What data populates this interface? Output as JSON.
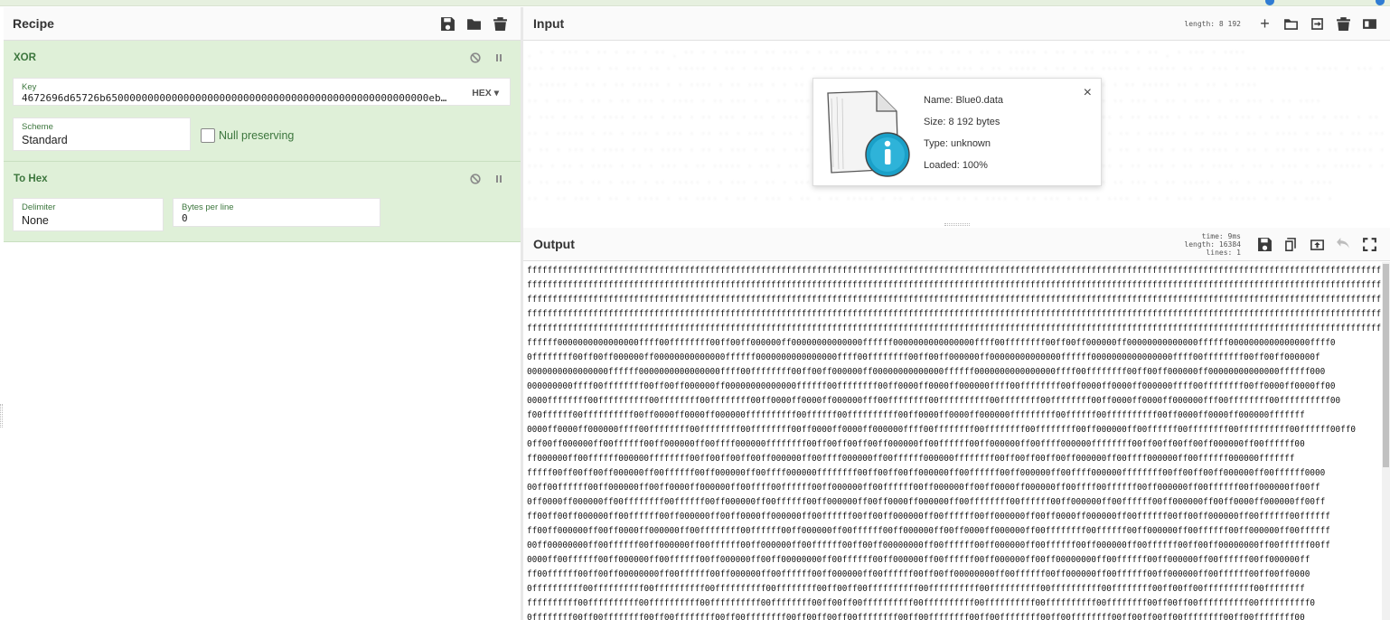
{
  "recipe": {
    "title": "Recipe",
    "icons": [
      "save-icon",
      "folder-icon",
      "trash-icon"
    ],
    "operations": [
      {
        "name": "XOR",
        "key_label": "Key",
        "key_value": "4672696d65726b650000000000000000000000000000000000000000000000000000eb…",
        "key_format": "HEX",
        "scheme_label": "Scheme",
        "scheme_value": "Standard",
        "null_preserving_label": "Null preserving",
        "null_preserving_checked": false
      },
      {
        "name": "To Hex",
        "delimiter_label": "Delimiter",
        "delimiter_value": "None",
        "bytes_per_line_label": "Bytes per line",
        "bytes_per_line_value": "0"
      }
    ]
  },
  "input": {
    "title": "Input",
    "length_text": "length: 8 192",
    "icons": [
      "plus-icon",
      "folder-icon",
      "input-file-icon",
      "trash-icon",
      "layout-icon"
    ]
  },
  "file_popup": {
    "name": "Name: Blue0.data",
    "size": "Size: 8 192 bytes",
    "type": "Type: unknown",
    "loaded": "Loaded: 100%",
    "close_label": "×"
  },
  "output": {
    "title": "Output",
    "time_text": "time:  9ms",
    "length_text": "length: 16384",
    "lines_text": "lines:    1",
    "icons": [
      "save-icon",
      "copy-icon",
      "replace-input-icon",
      "undo-icon",
      "fullscreen-icon"
    ],
    "lines": [
      "ffffffffffffffffffffffffffffffffffffffffffffffffffffffffffffffffffffffffffffffffffffffffffffffffffffffffffffffffffffffffffffffffffffffffffffffffffffffffffffffffffffffffffffffffffffffffffffffffff",
      "ffffffffffffffffffffffffffffffffffffffffffffffffffffffffffffffffffffffffffffffffffffffffffffffffffffffffffffffffffffffffffffffffffffffffffffffffffffffffffffffffffffffffffffffffffffffffffffffffffff",
      "ffffffffffffffffffffffffffffffffffffffffffffffffffffffffffffffffffffffffffffffffffffffffffffffffffffffffffffffffffffffffffffffffffffffffffffffffffffffffffffffffffffffffffffffffffffffffffffffffffff",
      "ffffffffffffffffffffffffffffffffffffffffffffffffffffffffffffffffffffffffffffffffffffffffffffffffffffffffffffffffffffffffffffffffffffffffffffffffffffffffffffffffffffffffffffffffffffffffffffffffffff",
      "ffffffffffffffffffffffffffffffffffffffffffffffffffffffffffffffffffffffffffffffffffffffffffffffffffffffffffffffffffffffffffffffffffffffffffffffffffffffffffffffffffffffffffffffffffffffffffffffffffff",
      "ffffff0000000000000000ffff00ffffffff00ff00ff000000ff00000000000000ffffff0000000000000000ffff00ffffffff00ff00ff000000ff00000000000000ffffff0000000000000000ffff0",
      "0ffffffff00ff00ff000000ff00000000000000ffffff0000000000000000ffff00ffffffff00ff00ff000000ff00000000000000ffffff0000000000000000ffff00ffffffff00ff00ff000000f",
      "0000000000000000ffffff0000000000000000ffff00ffffffff00ff00ff000000ff00000000000000ffffff0000000000000000ffff00ffffffff00ff00ff000000ff00000000000000ffffff000",
      "000000000ffff00ffffffff00ff00ff000000ff00000000000000ffffff00ffffffff00ff0000ff0000ff000000ffff00ffffffff00ff0000ff0000ff000000ffff00ffffffff00ff0000ff0000ff00",
      "0000ffffffff00ffffffffff00ffffffff00ffffffff00ff0000ff0000ff000000fff00ffffffff00ffffffffff00ffffffff00ffffffff00ff0000ff0000ff000000fff00ffffffff00ffffffffff00",
      "f00ffffff00ffffffffff00ff0000ff0000ff000000ffffffffff00ffffff00ffffffffff00ff0000ff0000ff000000fffffffff00ffffff00ffffffffff00ff0000ff0000ff000000fffffff",
      "0000ff0000ff000000ffff00ffffffff00ffffffff00ffffffff00ff0000ff0000ff000000ffff00ffffffff00ffffffff00ffffffff00ff000000ff00ffffff00ffffffff00ffffffffff00ffffff00ff0",
      "0ff00ff000000ff00ffffff00ff000000ff00ffff000000ffffffff00ff00ff00ff00ff000000ff00ffffff00ff000000ff00ffff000000ffffffff00ff00ff00ff00ff000000ff00ffffff00",
      "ff000000ff00ffffff000000ffffffff00ff00ff00ff00ff000000ff00ffff000000ff00ffffff000000ffffffff00ff00ff00ff00ff000000ff00ffff000000ff00ffffff000000fffffff",
      "fffff00ff00ff00ff000000ff00ffffff00ff000000ff00ffff000000ffffffff00ff00ff00ff000000ff00ffffff00ff000000ff00ffff000000ffffffff00ff00ff00ff000000ff00ffffff0000",
      "00ff00ffffff00ff000000ff00ff0000ff000000ff00ffff00ffffff00ff000000ff00ffffff00ff000000ff00ff0000ff000000ff00ffff00ffffff00ff000000ff00ffffff00ff000000ff00ff",
      "0ff0000ff000000ff00ffffffff00ffffff00ff000000ff00ffffff00ff000000ff00ff0000ff000000ff00ffffffff00ffffff00ff000000ff00ffffff00ff000000ff00ff0000ff000000ff00ff",
      "ff00ff00ff000000ff00ffffff00ff000000ff00ff0000ff000000ff00ffffff00ff00ff000000ff00ffffff00ff000000ff00ff0000ff000000ff00ffffff00ff00ff000000ff00ffffff00ffffff",
      "ff00ff000000ff00ff0000ff000000ff00ffffffff00ffffff00ff000000ff00ffffff00ff000000ff00ff0000ff000000ff00ffffffff00ffffff00ff000000ff00ffffff00ff000000ff00ffffff",
      "00ff00000000ff00ffffff00ff000000ff00ffffff00ff000000ff00ffffff00ff00ff00000000ff00ffffff00ff000000ff00ffffff00ff000000ff00ffffff00ff00ff00000000ff00ffffff00ff",
      "0000ff00ffffff00ff000000ff00ffffff00ff000000ff00ff00000000ff00ffffff00ff000000ff00ffffff00ff000000ff00ff00000000ff00ffffff00ff000000ff00ffffff00ff000000ff",
      "ff00ffffff00ff00ff00000000ff00ffffff00ff000000ff00ffffff00ff000000ff00ffffff00ff00ff00000000ff00ffffff00ff000000ff00ffffff00ff000000ff00ffffff00ff00ff0000",
      "0ffffffffff00ffffffffff00ffffffffff00ffffffffff00ffffffff00ff00ff00ffffffffff00ffffffffff00ffffffffff00ffffffffff00ffffffff00ff00ff00ffffffffff00ffffffff",
      "ffffffffff00ffffffffff00ffffffffff00ffffffffff00ffffffff00ff00ff00ffffffffff00ffffffffff00ffffffffff00ffffffffff00ffffffff00ff00ff00ffffffffff00ffffffffff0",
      "0ffffffff00ff00ffffffff00ff00ffffffff00ff00ffffffff00ff00ff00ff00ffffffff00ff00ffffffff00ff00ffffffff00ff00ffffffff00ff00ff00ff00ffffffff00ff00ffffffff00"
    ]
  },
  "colors": {
    "op_background": "#dff0d8",
    "op_text": "#3c763d",
    "accent_blue": "#2f7cd3"
  }
}
